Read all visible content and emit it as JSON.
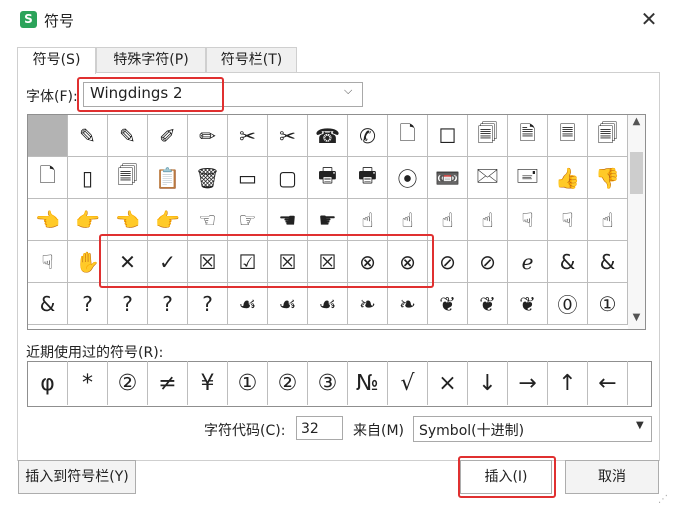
{
  "window": {
    "title": "符号",
    "app_icon": "S"
  },
  "tabs": [
    {
      "label": "符号(S)",
      "active": true
    },
    {
      "label": "特殊字符(P)",
      "active": false
    },
    {
      "label": "符号栏(T)",
      "active": false
    }
  ],
  "font": {
    "label": "字体(F):",
    "value": "Wingdings 2"
  },
  "symbol_grid": [
    [
      "",
      "✎",
      "✎",
      "✐",
      "✏",
      "✂",
      "✂",
      "☎",
      "✆",
      "🗋",
      "☐",
      "🗐",
      "🗎",
      "🗏",
      "🗐"
    ],
    [
      "🗋",
      "▯",
      "🗐",
      "📋",
      "🗑",
      "▭",
      "▢",
      "🖶",
      "🖶",
      "⦿",
      "📼",
      "🖂",
      "🖃",
      "👍",
      "👎"
    ],
    [
      "👈",
      "👉",
      "👈",
      "👉",
      "☜",
      "☞",
      "☚",
      "☛",
      "☝",
      "☝",
      "☝",
      "☝",
      "☟",
      "☟",
      "☝"
    ],
    [
      "☟",
      "✋",
      "✕",
      "✓",
      "☒",
      "☑",
      "☒",
      "☒",
      "⊗",
      "⊗",
      "⊘",
      "⊘",
      "ℯ",
      "&",
      "&"
    ],
    [
      "&",
      "?",
      "?",
      "?",
      "?",
      "☙",
      "☙",
      "☙",
      "❧",
      "❧",
      "❦",
      "❦",
      "❦",
      "⓪",
      "①"
    ]
  ],
  "recent": {
    "label": "近期使用过的符号(R):",
    "symbols": [
      "φ",
      "*",
      "②",
      "≠",
      "¥",
      "①",
      "②",
      "③",
      "№",
      "√",
      "×",
      "↓",
      "→",
      "↑",
      "←"
    ]
  },
  "char_code": {
    "label": "字符代码(C):",
    "value": "32"
  },
  "from": {
    "label": "来自(M)",
    "value": "Symbol(十进制)"
  },
  "buttons": {
    "insert_to_bar": "插入到符号栏(Y)",
    "insert": "插入(I)",
    "cancel": "取消"
  },
  "colors": {
    "highlight": "#e03030",
    "selected_cell": "#b3b3b3"
  }
}
